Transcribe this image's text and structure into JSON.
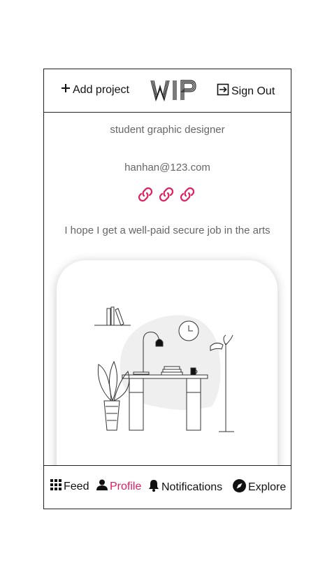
{
  "header": {
    "add_project_label": "Add project",
    "logo_text": "WIP",
    "sign_out_label": "Sign Out"
  },
  "profile": {
    "bio": "student graphic designer",
    "email": "hanhan@123.com",
    "links": [
      "link-icon",
      "link-icon",
      "link-icon"
    ],
    "quote": "I hope I get a well-paid secure job in the arts"
  },
  "nav": {
    "items": [
      {
        "label": "Feed",
        "icon": "grid-icon"
      },
      {
        "label": "Profile",
        "icon": "user-icon",
        "active": true
      },
      {
        "label": "Notifications",
        "icon": "bell-icon"
      },
      {
        "label": "Explore",
        "icon": "compass-icon"
      }
    ]
  },
  "colors": {
    "accent": "#e01f5c",
    "muted_text": "#666666",
    "border": "#222222"
  }
}
